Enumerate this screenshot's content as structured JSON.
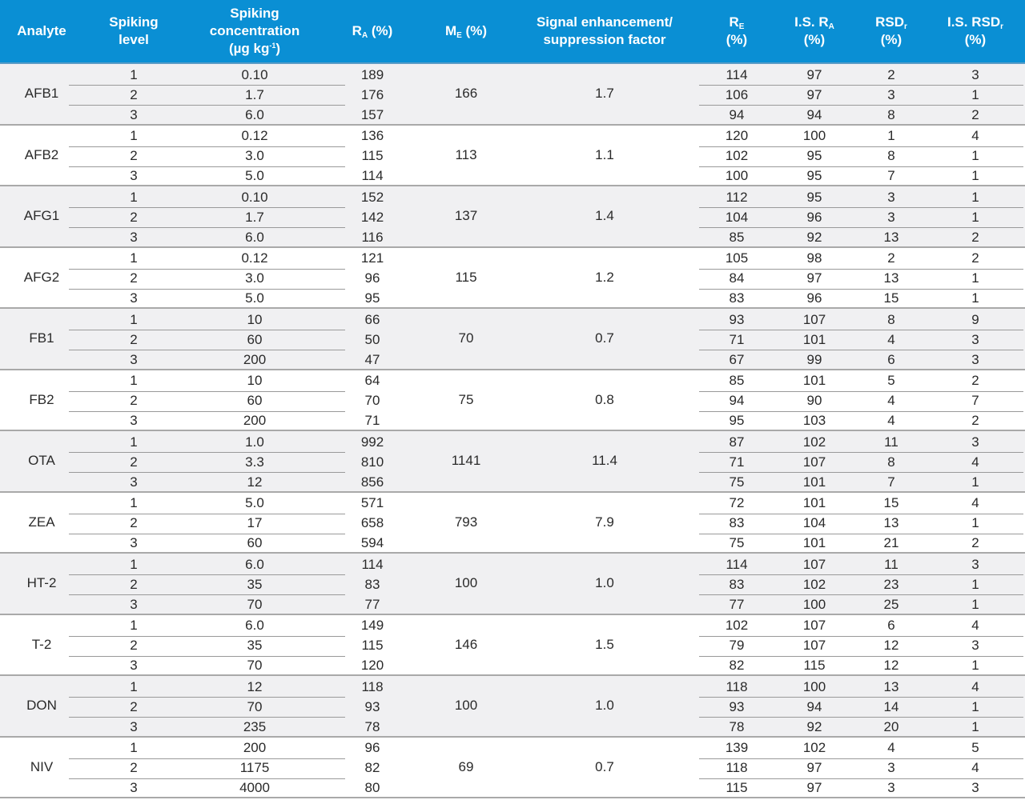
{
  "colors": {
    "header_bg": "#0a8fd4",
    "header_text": "#ffffff",
    "shaded_row": "#f0f0f2",
    "rule": "#a9a9a9"
  },
  "headers": {
    "analyte": "Analyte",
    "spiking_level_1": "Spiking",
    "spiking_level_2": "level",
    "conc_1": "Spiking",
    "conc_2": "concentration",
    "conc_3_pre": "(µg kg",
    "conc_3_sup": "-1",
    "conc_3_post": ")",
    "ra_main": "R",
    "ra_sub": "A",
    "ra_unit": " (%)",
    "me_main": "M",
    "me_sub": "E",
    "me_unit": " (%)",
    "se_1": "Signal enhancement/",
    "se_2": "suppression factor",
    "re_main": "R",
    "re_sub": "E",
    "re_unit": "(%)",
    "isra_main": "I.S. R",
    "isra_sub": "A",
    "isra_unit": "(%)",
    "rsd_main": "RSD",
    "rsd_sub": "r",
    "rsd_unit": "(%)",
    "isrsd_main": "I.S. RSD",
    "isrsd_sub": "r",
    "isrsd_unit": "(%)"
  },
  "groups": [
    {
      "analyte": "AFB1",
      "me": "166",
      "se": "1.7",
      "rows": [
        {
          "level": "1",
          "conc": "0.10",
          "ra": "189",
          "re": "114",
          "isra": "97",
          "rsd": "2",
          "isrsd": "3"
        },
        {
          "level": "2",
          "conc": "1.7",
          "ra": "176",
          "re": "106",
          "isra": "97",
          "rsd": "3",
          "isrsd": "1"
        },
        {
          "level": "3",
          "conc": "6.0",
          "ra": "157",
          "re": "94",
          "isra": "94",
          "rsd": "8",
          "isrsd": "2"
        }
      ]
    },
    {
      "analyte": "AFB2",
      "me": "113",
      "se": "1.1",
      "rows": [
        {
          "level": "1",
          "conc": "0.12",
          "ra": "136",
          "re": "120",
          "isra": "100",
          "rsd": "1",
          "isrsd": "4"
        },
        {
          "level": "2",
          "conc": "3.0",
          "ra": "115",
          "re": "102",
          "isra": "95",
          "rsd": "8",
          "isrsd": "1"
        },
        {
          "level": "3",
          "conc": "5.0",
          "ra": "114",
          "re": "100",
          "isra": "95",
          "rsd": "7",
          "isrsd": "1"
        }
      ]
    },
    {
      "analyte": "AFG1",
      "me": "137",
      "se": "1.4",
      "rows": [
        {
          "level": "1",
          "conc": "0.10",
          "ra": "152",
          "re": "112",
          "isra": "95",
          "rsd": "3",
          "isrsd": "1"
        },
        {
          "level": "2",
          "conc": "1.7",
          "ra": "142",
          "re": "104",
          "isra": "96",
          "rsd": "3",
          "isrsd": "1"
        },
        {
          "level": "3",
          "conc": "6.0",
          "ra": "116",
          "re": "85",
          "isra": "92",
          "rsd": "13",
          "isrsd": "2"
        }
      ]
    },
    {
      "analyte": "AFG2",
      "me": "115",
      "se": "1.2",
      "rows": [
        {
          "level": "1",
          "conc": "0.12",
          "ra": "121",
          "re": "105",
          "isra": "98",
          "rsd": "2",
          "isrsd": "2"
        },
        {
          "level": "2",
          "conc": "3.0",
          "ra": "96",
          "re": "84",
          "isra": "97",
          "rsd": "13",
          "isrsd": "1"
        },
        {
          "level": "3",
          "conc": "5.0",
          "ra": "95",
          "re": "83",
          "isra": "96",
          "rsd": "15",
          "isrsd": "1"
        }
      ]
    },
    {
      "analyte": "FB1",
      "me": "70",
      "se": "0.7",
      "rows": [
        {
          "level": "1",
          "conc": "10",
          "ra": "66",
          "re": "93",
          "isra": "107",
          "rsd": "8",
          "isrsd": "9"
        },
        {
          "level": "2",
          "conc": "60",
          "ra": "50",
          "re": "71",
          "isra": "101",
          "rsd": "4",
          "isrsd": "3"
        },
        {
          "level": "3",
          "conc": "200",
          "ra": "47",
          "re": "67",
          "isra": "99",
          "rsd": "6",
          "isrsd": "3"
        }
      ]
    },
    {
      "analyte": "FB2",
      "me": "75",
      "se": "0.8",
      "rows": [
        {
          "level": "1",
          "conc": "10",
          "ra": "64",
          "re": "85",
          "isra": "101",
          "rsd": "5",
          "isrsd": "2"
        },
        {
          "level": "2",
          "conc": "60",
          "ra": "70",
          "re": "94",
          "isra": "90",
          "rsd": "4",
          "isrsd": "7"
        },
        {
          "level": "3",
          "conc": "200",
          "ra": "71",
          "re": "95",
          "isra": "103",
          "rsd": "4",
          "isrsd": "2"
        }
      ]
    },
    {
      "analyte": "OTA",
      "me": "1141",
      "se": "11.4",
      "rows": [
        {
          "level": "1",
          "conc": "1.0",
          "ra": "992",
          "re": "87",
          "isra": "102",
          "rsd": "11",
          "isrsd": "3"
        },
        {
          "level": "2",
          "conc": "3.3",
          "ra": "810",
          "re": "71",
          "isra": "107",
          "rsd": "8",
          "isrsd": "4"
        },
        {
          "level": "3",
          "conc": "12",
          "ra": "856",
          "re": "75",
          "isra": "101",
          "rsd": "7",
          "isrsd": "1"
        }
      ]
    },
    {
      "analyte": "ZEA",
      "me": "793",
      "se": "7.9",
      "rows": [
        {
          "level": "1",
          "conc": "5.0",
          "ra": "571",
          "re": "72",
          "isra": "101",
          "rsd": "15",
          "isrsd": "4"
        },
        {
          "level": "2",
          "conc": "17",
          "ra": "658",
          "re": "83",
          "isra": "104",
          "rsd": "13",
          "isrsd": "1"
        },
        {
          "level": "3",
          "conc": "60",
          "ra": "594",
          "re": "75",
          "isra": "101",
          "rsd": "21",
          "isrsd": "2"
        }
      ]
    },
    {
      "analyte": "HT-2",
      "me": "100",
      "se": "1.0",
      "rows": [
        {
          "level": "1",
          "conc": "6.0",
          "ra": "114",
          "re": "114",
          "isra": "107",
          "rsd": "11",
          "isrsd": "3"
        },
        {
          "level": "2",
          "conc": "35",
          "ra": "83",
          "re": "83",
          "isra": "102",
          "rsd": "23",
          "isrsd": "1"
        },
        {
          "level": "3",
          "conc": "70",
          "ra": "77",
          "re": "77",
          "isra": "100",
          "rsd": "25",
          "isrsd": "1"
        }
      ]
    },
    {
      "analyte": "T-2",
      "me": "146",
      "se": "1.5",
      "rows": [
        {
          "level": "1",
          "conc": "6.0",
          "ra": "149",
          "re": "102",
          "isra": "107",
          "rsd": "6",
          "isrsd": "4"
        },
        {
          "level": "2",
          "conc": "35",
          "ra": "115",
          "re": "79",
          "isra": "107",
          "rsd": "12",
          "isrsd": "3"
        },
        {
          "level": "3",
          "conc": "70",
          "ra": "120",
          "re": "82",
          "isra": "115",
          "rsd": "12",
          "isrsd": "1"
        }
      ]
    },
    {
      "analyte": "DON",
      "me": "100",
      "se": "1.0",
      "rows": [
        {
          "level": "1",
          "conc": "12",
          "ra": "118",
          "re": "118",
          "isra": "100",
          "rsd": "13",
          "isrsd": "4"
        },
        {
          "level": "2",
          "conc": "70",
          "ra": "93",
          "re": "93",
          "isra": "94",
          "rsd": "14",
          "isrsd": "1"
        },
        {
          "level": "3",
          "conc": "235",
          "ra": "78",
          "re": "78",
          "isra": "92",
          "rsd": "20",
          "isrsd": "1"
        }
      ]
    },
    {
      "analyte": "NIV",
      "me": "69",
      "se": "0.7",
      "rows": [
        {
          "level": "1",
          "conc": "200",
          "ra": "96",
          "re": "139",
          "isra": "102",
          "rsd": "4",
          "isrsd": "5"
        },
        {
          "level": "2",
          "conc": "1175",
          "ra": "82",
          "re": "118",
          "isra": "97",
          "rsd": "3",
          "isrsd": "4"
        },
        {
          "level": "3",
          "conc": "4000",
          "ra": "80",
          "re": "115",
          "isra": "97",
          "rsd": "3",
          "isrsd": "3"
        }
      ]
    }
  ]
}
